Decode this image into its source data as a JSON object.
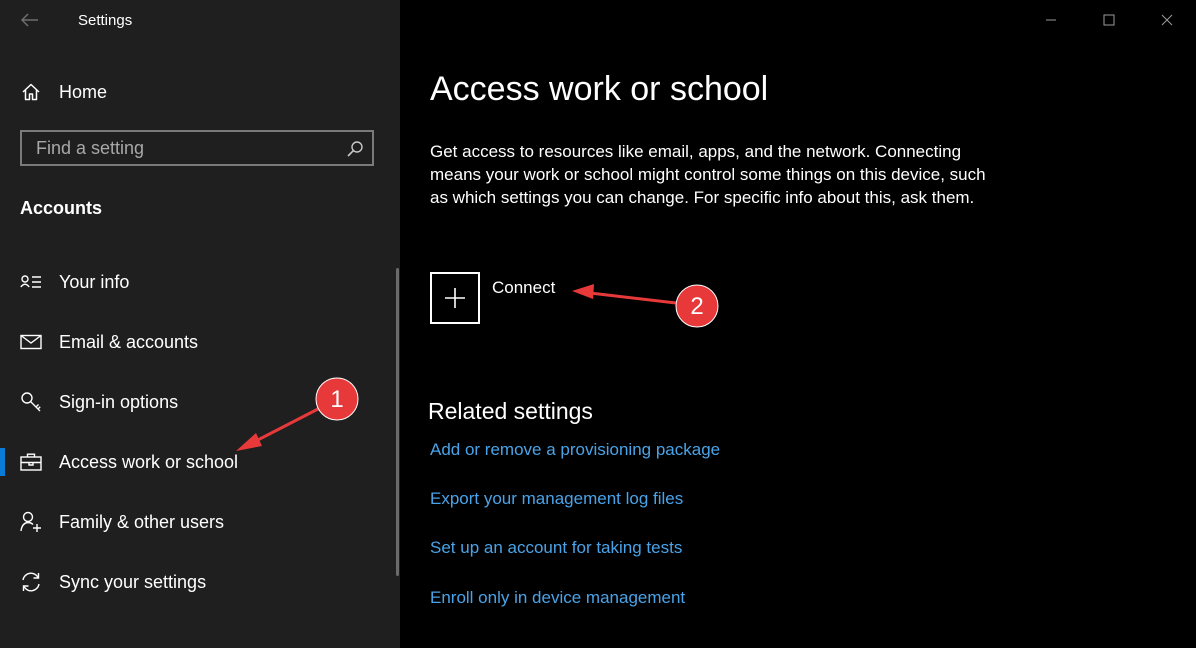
{
  "window": {
    "title": "Settings",
    "colors": {
      "sidebar_bg": "#1f1f1f",
      "main_bg": "#000000",
      "accent": "#0a7bd6",
      "link": "#4aa3e8",
      "annotation": "#e8393a"
    }
  },
  "sidebar": {
    "home_label": "Home",
    "search_placeholder": "Find a setting",
    "section_title": "Accounts",
    "items": [
      {
        "label": "Your info",
        "icon": "person-card-icon"
      },
      {
        "label": "Email & accounts",
        "icon": "mail-icon"
      },
      {
        "label": "Sign-in options",
        "icon": "key-icon"
      },
      {
        "label": "Access work or school",
        "icon": "briefcase-icon",
        "selected": true
      },
      {
        "label": "Family & other users",
        "icon": "person-add-icon"
      },
      {
        "label": "Sync your settings",
        "icon": "sync-icon"
      }
    ]
  },
  "main": {
    "title": "Access work or school",
    "description": "Get access to resources like email, apps, and the network. Connecting means your work or school might control some things on this device, such as which settings you can change. For specific info about this, ask them.",
    "connect_label": "Connect",
    "related_title": "Related settings",
    "links": [
      "Add or remove a provisioning package",
      "Export your management log files",
      "Set up an account for taking tests",
      "Enroll only in device management"
    ]
  },
  "annotations": {
    "badge1": "1",
    "badge2": "2"
  }
}
